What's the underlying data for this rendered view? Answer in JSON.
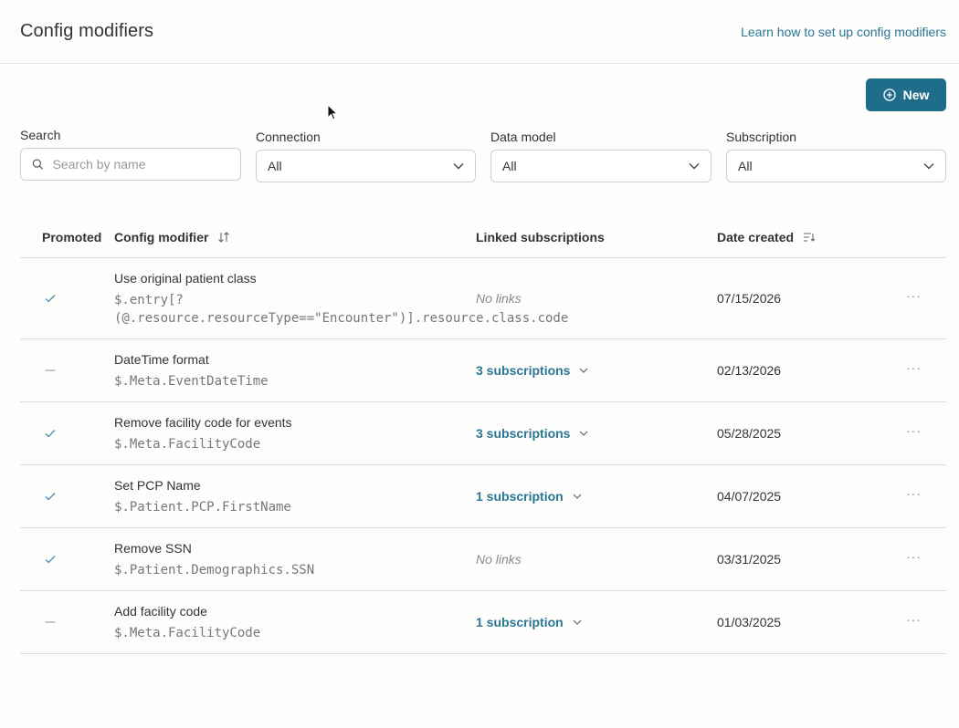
{
  "header": {
    "title": "Config modifiers",
    "help_link": "Learn how to set up config modifiers"
  },
  "actions": {
    "new_label": "New"
  },
  "filters": {
    "search": {
      "label": "Search",
      "placeholder": "Search by name"
    },
    "connection": {
      "label": "Connection",
      "value": "All"
    },
    "data_model": {
      "label": "Data model",
      "value": "All"
    },
    "subscription": {
      "label": "Subscription",
      "value": "All"
    }
  },
  "table": {
    "columns": {
      "promoted": "Promoted",
      "config_modifier": "Config modifier",
      "linked": "Linked subscriptions",
      "date": "Date created"
    },
    "rows": [
      {
        "promoted": true,
        "name": "Use original patient class",
        "path_line1": "$.entry[?",
        "path_line2": "(@.resource.resourceType==\"Encounter\")].resource.class.code",
        "links": "No links",
        "has_links": false,
        "date": "07/15/2026"
      },
      {
        "promoted": false,
        "name": "DateTime format",
        "path_line1": "$.Meta.EventDateTime",
        "links": "3 subscriptions",
        "has_links": true,
        "date": "02/13/2026"
      },
      {
        "promoted": true,
        "name": "Remove facility code for events",
        "path_line1": "$.Meta.FacilityCode",
        "links": "3 subscriptions",
        "has_links": true,
        "date": "05/28/2025"
      },
      {
        "promoted": true,
        "name": "Set PCP Name",
        "path_line1": "$.Patient.PCP.FirstName",
        "links": "1 subscription",
        "has_links": true,
        "date": "04/07/2025"
      },
      {
        "promoted": true,
        "name": "Remove SSN",
        "path_line1": "$.Patient.Demographics.SSN",
        "links": "No links",
        "has_links": false,
        "date": "03/31/2025"
      },
      {
        "promoted": false,
        "name": "Add facility code",
        "path_line1": "$.Meta.FacilityCode",
        "links": "1 subscription",
        "has_links": true,
        "date": "01/03/2025"
      }
    ]
  },
  "colors": {
    "accent": "#1f6d8a",
    "link": "#2a7694",
    "check": "#4a8fae"
  },
  "icons": {
    "new": "plus-circle-icon",
    "search": "search-icon",
    "dropdown": "chevron-down-icon",
    "sort": "sort-icon",
    "more": "more-icon",
    "promoted": "check-icon",
    "not_promoted": "dash-icon"
  }
}
